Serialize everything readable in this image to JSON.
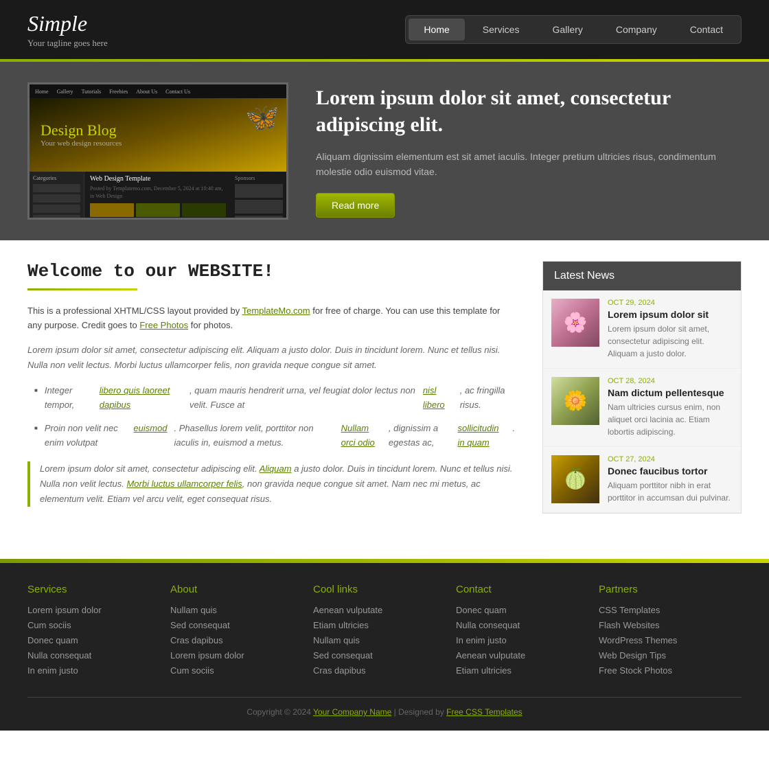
{
  "header": {
    "logo_title": "Simple",
    "logo_tagline": "Your tagline goes here",
    "nav": [
      {
        "label": "Home",
        "active": true
      },
      {
        "label": "Services",
        "active": false
      },
      {
        "label": "Gallery",
        "active": false
      },
      {
        "label": "Company",
        "active": false
      },
      {
        "label": "Contact",
        "active": false
      }
    ]
  },
  "hero": {
    "heading": "Lorem ipsum dolor sit amet, consectetur adipiscing elit.",
    "description": "Aliquam dignissim elementum est sit amet iaculis. Integer pretium ultricies risus, condimentum molestie odio euismod vitae.",
    "read_more": "Read more",
    "image_blog_title": "Design Blog",
    "image_blog_subtitle": "Your web design resources",
    "image_nav": [
      "Home",
      "Gallery",
      "Tutorials",
      "Freebies",
      "About Us",
      "Contact Us"
    ],
    "image_article_title": "Web Design Template"
  },
  "main": {
    "welcome_title": "Welcome to our WEBSITE!",
    "intro_paragraph": "This is a professional XHTML/CSS layout provided by TemplateMo.com for free of charge. You can use this template for any purpose. Credit goes to Free Photos for photos.",
    "body_paragraph": "Lorem ipsum dolor sit amet, consectetur adipiscing elit. Aliquam a justo dolor. Duis in tincidunt lorem. Nunc et tellus nisi. Nulla non velit lectus. Morbi luctus ullamcorper felis, non gravida neque congue sit amet.",
    "bullet1": "Integer tempor, libero quis laoreet dapibus, quam mauris hendrerit urna, vel feugiat dolor lectus non velit. Fusce at nisl libero, ac fringilla risus.",
    "bullet2": "Proin non velit nec enim volutpat euismod. Phasellus lorem velit, porttitor non iaculis in, euismod a metus. Nullam orci odio, dignissim a egestas ac, sollicitudin in quam.",
    "blockquote": "Lorem ipsum dolor sit amet, consectetur adipiscing elit. Aliquam a justo dolor. Duis in tincidunt lorem. Nunc et tellus nisi. Nulla non velit lectus. Morbi luctus ullamcorper felis, non gravida neque congue sit amet. Nam nec mi metus, ac elementum velit. Etiam vel arcu velit, eget consequat risus."
  },
  "news": {
    "header": "Latest News",
    "items": [
      {
        "date": "OCT 29, 2024",
        "title": "Lorem ipsum dolor sit",
        "description": "Lorem ipsum dolor sit amet, consectetur adipiscing elit. Aliquam a justo dolor.",
        "thumb_class": "news-thumb-1"
      },
      {
        "date": "OCT 28, 2024",
        "title": "Nam dictum pellentesque",
        "description": "Nam ultricies cursus enim, non aliquet orci lacinia ac. Etiam lobortis adipiscing.",
        "thumb_class": "news-thumb-2"
      },
      {
        "date": "OCT 27, 2024",
        "title": "Donec faucibus tortor",
        "description": "Aliquam porttitor nibh in erat porttitor in accumsan dui pulvinar.",
        "thumb_class": "news-thumb-3"
      }
    ]
  },
  "footer": {
    "columns": [
      {
        "title": "Services",
        "links": [
          "Lorem ipsum dolor",
          "Cum sociis",
          "Donec quam",
          "Nulla consequat",
          "In enim justo"
        ]
      },
      {
        "title": "About",
        "links": [
          "Nullam quis",
          "Sed consequat",
          "Cras dapibus",
          "Lorem ipsum dolor",
          "Cum sociis"
        ]
      },
      {
        "title": "Cool links",
        "links": [
          "Aenean vulputate",
          "Etiam ultricies",
          "Nullam quis",
          "Sed consequat",
          "Cras dapibus"
        ]
      },
      {
        "title": "Contact",
        "links": [
          "Donec quam",
          "Nulla consequat",
          "In enim justo",
          "Aenean vulputate",
          "Etiam ultricies"
        ]
      },
      {
        "title": "Partners",
        "links": [
          "CSS Templates",
          "Flash Websites",
          "WordPress Themes",
          "Web Design Tips",
          "Free Stock Photos"
        ]
      }
    ],
    "copyright": "Copyright © 2024",
    "company_name": "Your Company Name",
    "designed_by": "Designed by",
    "designer": "Free CSS Templates"
  }
}
